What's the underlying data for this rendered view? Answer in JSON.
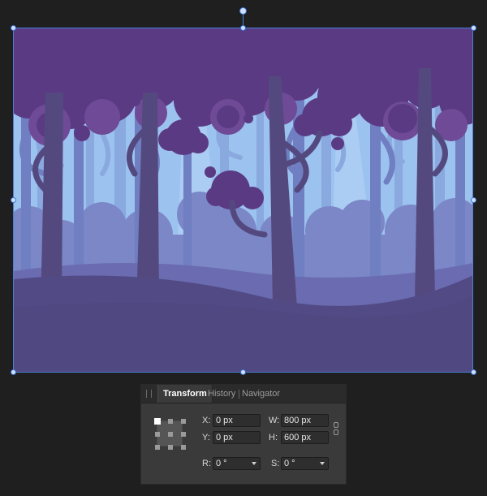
{
  "canvas": {
    "artwork_name": "purple-forest-illustration",
    "colors": {
      "sky": "#9cc2ef",
      "canopy": "#5b3a84",
      "canopy_light": "#6e4a97",
      "far_trees": "#89a9df",
      "mid_trees": "#6f7fc1",
      "bushes": "#7b87c6",
      "foreground_trunks": "#54497f",
      "ground": "#524a85",
      "selection": "#4a7fd6"
    }
  },
  "transform_panel": {
    "tabs": [
      {
        "label": "Transform",
        "active": true
      },
      {
        "label": "History",
        "active": false
      },
      {
        "label": "Navigator",
        "active": false
      }
    ],
    "x_label": "X:",
    "x_value": "0 px",
    "y_label": "Y:",
    "y_value": "0 px",
    "w_label": "W:",
    "w_value": "800 px",
    "h_label": "H:",
    "h_value": "600 px",
    "r_label": "R:",
    "r_value": "0 °",
    "s_label": "S:",
    "s_value": "0 °"
  }
}
